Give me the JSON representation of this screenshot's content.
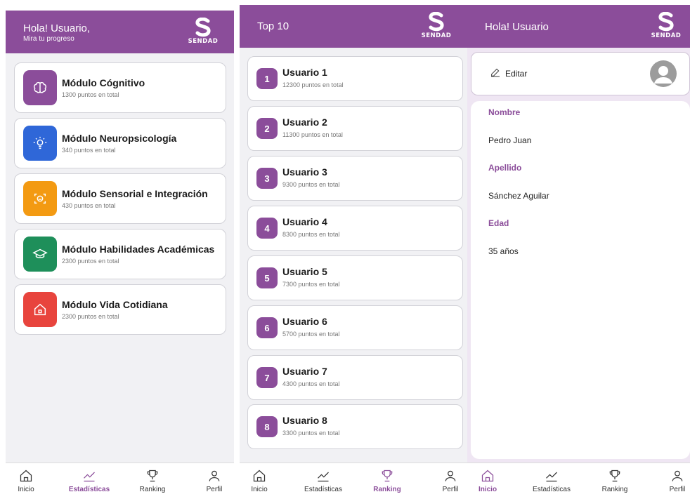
{
  "screen1": {
    "greeting": "Hola! Usuario,",
    "subtitle": "Mira tu progreso",
    "logo_text": "SENDAD",
    "modules": [
      {
        "title": "Módulo Cógnitivo",
        "points": "1300 puntos en total",
        "color": "#8b4d9a",
        "icon": "brain-icon"
      },
      {
        "title": "Módulo Neuropsicología",
        "points": "340 puntos en total",
        "color": "#2f67d8",
        "icon": "lightbulb-icon"
      },
      {
        "title": "Módulo Sensorial e Integración",
        "points": "430 puntos en total",
        "color": "#f39a12",
        "icon": "face-scan-icon"
      },
      {
        "title": "Módulo Habilidades Académicas",
        "points": "2300 puntos en total",
        "color": "#1e8f5a",
        "icon": "graduation-cap-icon"
      },
      {
        "title": "Módulo Vida Cotidiana",
        "points": "2300 puntos en total",
        "color": "#e8443d",
        "icon": "home-icon"
      }
    ],
    "nav": {
      "inicio": "Inicio",
      "estadisticas": "Estadísticas",
      "ranking": "Ranking",
      "perfil": "Perfil",
      "active": "estadisticas"
    }
  },
  "screen2": {
    "title": "Top 10",
    "logo_text": "SENDAD",
    "ranking": [
      {
        "pos": "1",
        "name": "Usuario 1",
        "points": "12300 puntos en total"
      },
      {
        "pos": "2",
        "name": "Usuario 2",
        "points": "11300 puntos en total"
      },
      {
        "pos": "3",
        "name": "Usuario 3",
        "points": "9300 puntos en total"
      },
      {
        "pos": "4",
        "name": "Usuario 4",
        "points": "8300 puntos en total"
      },
      {
        "pos": "5",
        "name": "Usuario 5",
        "points": "7300 puntos en total"
      },
      {
        "pos": "6",
        "name": "Usuario 6",
        "points": "5700 puntos en total"
      },
      {
        "pos": "7",
        "name": "Usuario 7",
        "points": "4300 puntos en total"
      },
      {
        "pos": "8",
        "name": "Usuario 8",
        "points": "3300 puntos en total"
      }
    ],
    "nav": {
      "inicio": "Inicio",
      "estadisticas": "Estadísticas",
      "ranking": "Ranking",
      "perfil": "Perfil",
      "active": "ranking"
    }
  },
  "screen3": {
    "greeting": "Hola! Usuario",
    "logo_text": "SENDAD",
    "edit_label": "Editar",
    "fields": [
      {
        "label": "Nombre",
        "value": "Pedro Juan"
      },
      {
        "label": "Apellido",
        "value": "Sánchez Aguilar"
      },
      {
        "label": "Edad",
        "value": "35 años"
      }
    ],
    "nav": {
      "inicio": "Inicio",
      "estadisticas": "Estadísticas",
      "ranking": "Ranking",
      "perfil": "Perfil",
      "active": "inicio"
    }
  },
  "colors": {
    "brand": "#8b4d9a",
    "background": "#f1f1f4"
  }
}
